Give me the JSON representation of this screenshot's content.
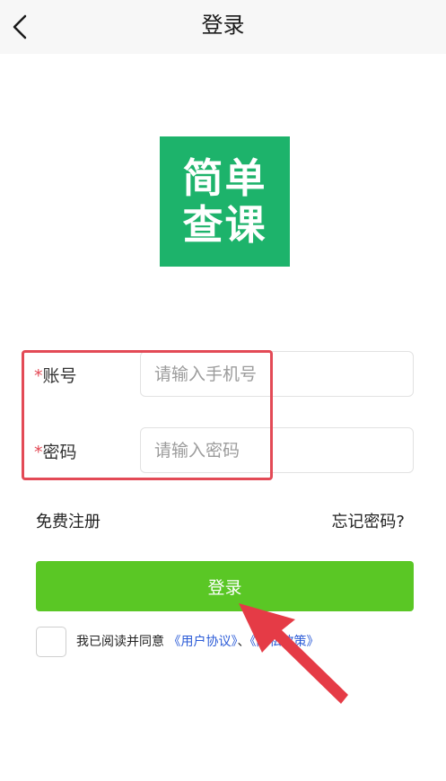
{
  "header": {
    "title": "登录",
    "back_icon": "chevron-left-icon"
  },
  "logo": {
    "line1": "简单",
    "line2": "查课",
    "color": "#1db36b"
  },
  "form": {
    "account": {
      "required_mark": "*",
      "label": "账号",
      "placeholder": "请输入手机号"
    },
    "password": {
      "required_mark": "*",
      "label": "密码",
      "placeholder": "请输入密码"
    }
  },
  "links": {
    "register": "免费注册",
    "forgot_password": "忘记密码?"
  },
  "login_button": {
    "label": "登录",
    "color": "#5ac725"
  },
  "agreement": {
    "prefix": "我已阅读并同意",
    "user_agreement": "《用户协议》",
    "separator": "、",
    "privacy_policy": "《隐私政策》",
    "checked": false
  },
  "annotations": {
    "highlight_color": "#e34a56",
    "arrow_color": "#e53b46"
  }
}
